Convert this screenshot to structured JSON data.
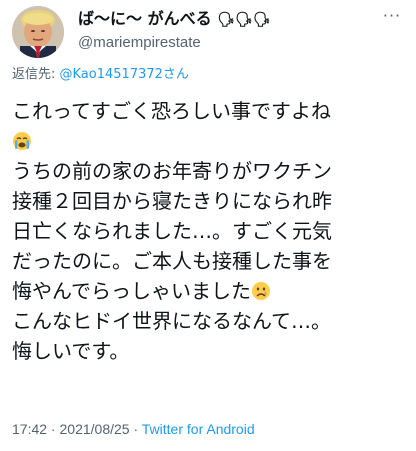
{
  "author": {
    "display_name": "ば〜に〜 がんべる",
    "name_emoji": "🗣🗣🗣",
    "handle": "@mariempirestate",
    "more_label": "···"
  },
  "reply": {
    "prefix": "返信先: ",
    "mention": "@Kao14517372さん"
  },
  "body": {
    "line1": "これってすごく恐ろしい事ですよね",
    "line2": "😭",
    "line3": "うちの前の家のお年寄りがワクチン",
    "line4": "接種２回目から寝たきりになられ昨",
    "line5": "日亡くなられました…。すごく元気",
    "line6": "だったのに。ご本人も接種した事を",
    "line7": "悔やんでらっしゃいました",
    "line7_emoji": "😢",
    "line8": "こんなヒドイ世界になるなんて…。",
    "line9": "悔しいです。"
  },
  "meta": {
    "time": "17:42",
    "separator1": " · ",
    "date": "2021/08/25",
    "separator2": " · ",
    "source": "Twitter for Android"
  }
}
